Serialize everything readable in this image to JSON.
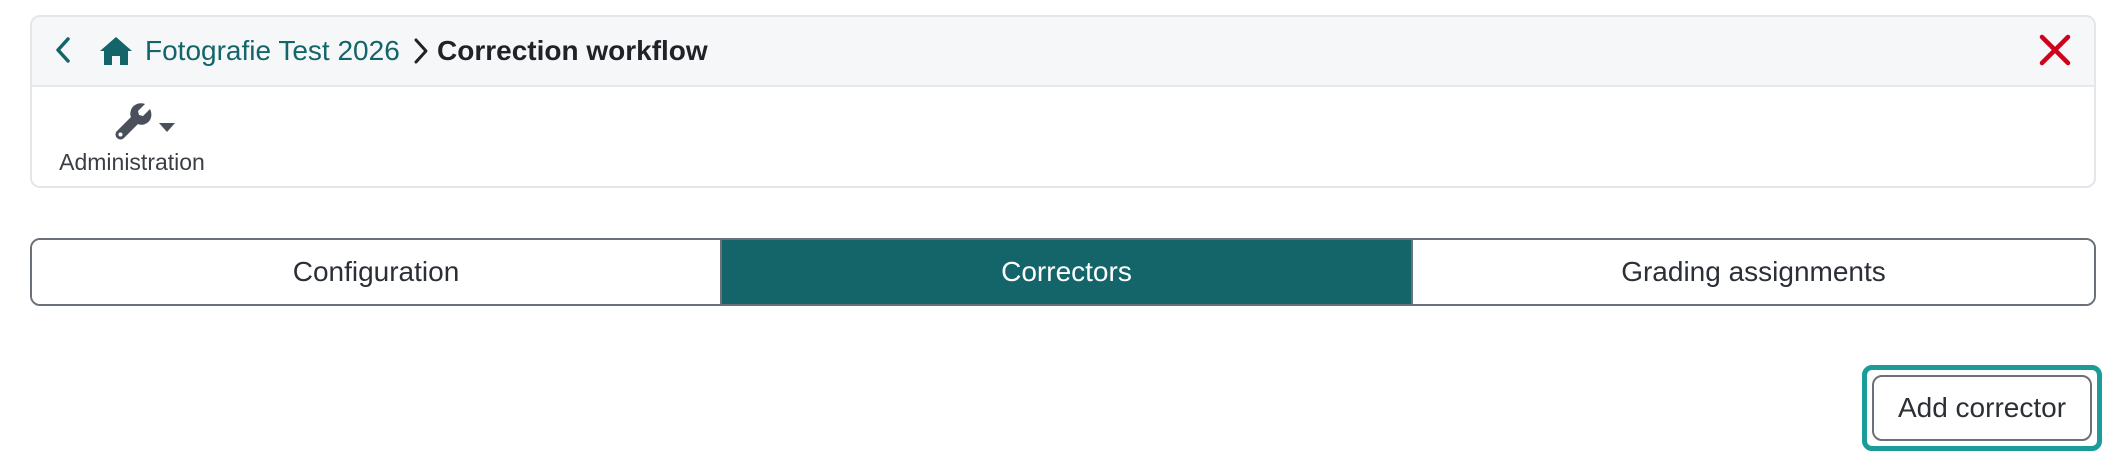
{
  "header": {
    "back_icon": "chevron-left-icon",
    "home_icon": "home-icon",
    "breadcrumb_parent": "Fotografie Test 2026",
    "breadcrumb_separator_icon": "chevron-right-icon",
    "breadcrumb_current": "Correction workflow",
    "close_icon": "close-icon",
    "close_color": "#d0021b"
  },
  "toolbar": {
    "admin_icon": "wrench-icon",
    "admin_caret_icon": "caret-down-icon",
    "admin_label": "Administration"
  },
  "tabs": [
    {
      "label": "Configuration",
      "active": false
    },
    {
      "label": "Correctors",
      "active": true
    },
    {
      "label": "Grading assignments",
      "active": false
    }
  ],
  "actions": {
    "add_corrector_label": "Add corrector",
    "focused": true
  },
  "colors": {
    "accent": "#14656a",
    "focus_ring": "#1b9b9a",
    "danger": "#d0021b"
  }
}
